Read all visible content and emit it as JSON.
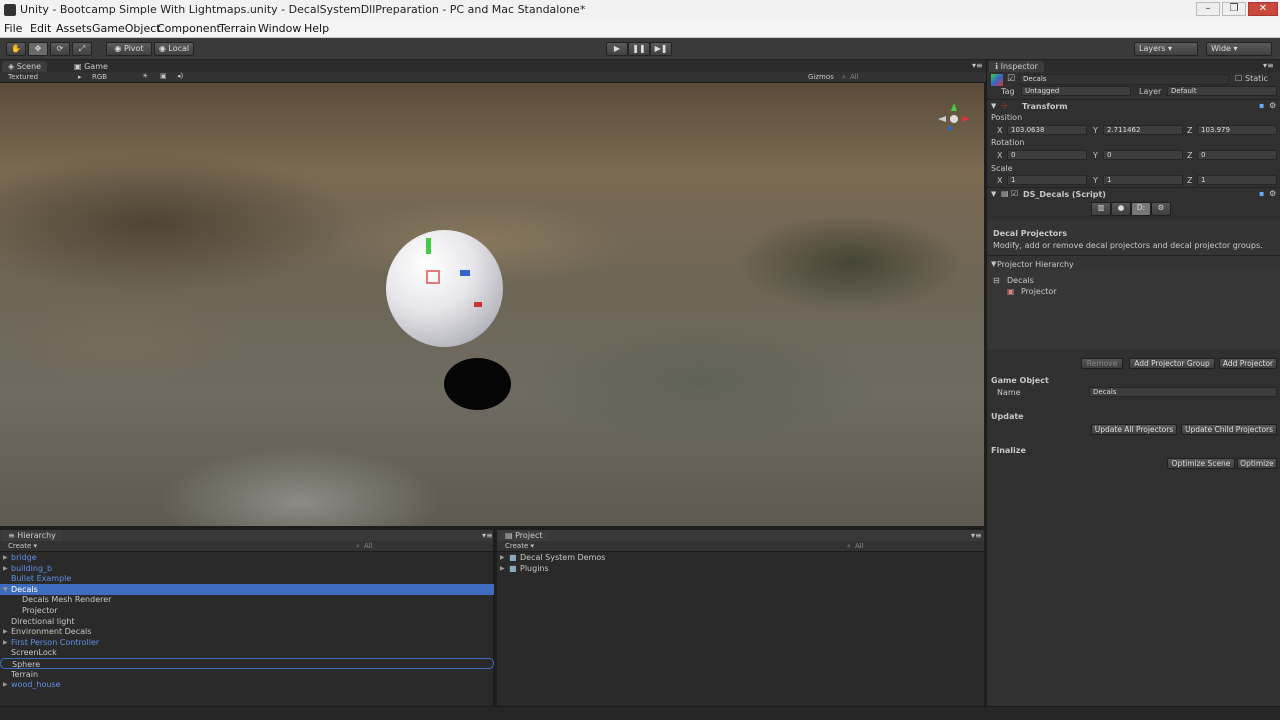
{
  "window": {
    "title": "Unity - Bootcamp Simple With Lightmaps.unity - DecalSystemDllPreparation - PC and Mac Standalone*",
    "minimize": "–",
    "maximize": "❐",
    "close": "✕"
  },
  "menu": [
    "File",
    "Edit",
    "Assets",
    "GameObject",
    "Component",
    "Terrain",
    "Window",
    "Help"
  ],
  "toolbar": {
    "pivot": "Pivot",
    "local": "Local",
    "layers": "Layers",
    "layout": "Wide"
  },
  "scene": {
    "tabs": [
      "Scene",
      "Game"
    ],
    "render_mode": "Textured",
    "color_mode": "RGB",
    "gizmos": "Gizmos",
    "search": "All"
  },
  "inspector": {
    "tab": "Inspector",
    "object_name": "Decals",
    "static_label": "Static",
    "tag_label": "Tag",
    "tag_value": "Untagged",
    "layer_label": "Layer",
    "layer_value": "Default",
    "transform": {
      "title": "Transform",
      "position_label": "Position",
      "position": {
        "x": "103.0638",
        "y": "2.711462",
        "z": "103.979"
      },
      "rotation_label": "Rotation",
      "rotation": {
        "x": "0",
        "y": "0",
        "z": "0"
      },
      "scale_label": "Scale",
      "scale": {
        "x": "1",
        "y": "1",
        "z": "1"
      }
    },
    "script": {
      "title": "DS_Decals (Script)",
      "section_title": "Decal Projectors",
      "description": "Modify, add or remove decal projectors and decal projector groups.",
      "hierarchy_label": "Projector Hierarchy",
      "tree_root": "Decals",
      "tree_child": "Projector",
      "remove_button": "Remove",
      "add_group_button": "Add Projector Group",
      "add_projector_button": "Add Projector",
      "game_object_title": "Game Object",
      "name_label": "Name",
      "name_value": "Decals",
      "update_title": "Update",
      "update_all_button": "Update All Projectors",
      "update_child_button": "Update Child Projectors",
      "finalize_title": "Finalize",
      "optimize_scene_button": "Optimize Scene",
      "optimize_button": "Optimize"
    }
  },
  "hierarchy": {
    "tab": "Hierarchy",
    "create": "Create",
    "search": "All",
    "items": [
      {
        "label": "bridge",
        "link": true,
        "arrow": true,
        "indent": 0
      },
      {
        "label": "building_b",
        "link": true,
        "arrow": true,
        "indent": 0
      },
      {
        "label": "Bullet Example",
        "link": true,
        "arrow": false,
        "indent": 0
      },
      {
        "label": "Decals",
        "link": false,
        "arrow": true,
        "indent": 0,
        "selected": true
      },
      {
        "label": "Decals Mesh Renderer",
        "link": false,
        "arrow": false,
        "indent": 1
      },
      {
        "label": "Projector",
        "link": false,
        "arrow": false,
        "indent": 1
      },
      {
        "label": "Directional light",
        "link": false,
        "arrow": false,
        "indent": 0
      },
      {
        "label": "Environment Decals",
        "link": false,
        "arrow": true,
        "indent": 0
      },
      {
        "label": "First Person Controller",
        "link": true,
        "arrow": true,
        "indent": 0
      },
      {
        "label": "ScreenLock",
        "link": false,
        "arrow": false,
        "indent": 0
      },
      {
        "label": "Sphere",
        "link": false,
        "arrow": false,
        "indent": 0,
        "outlined": true
      },
      {
        "label": "Terrain",
        "link": false,
        "arrow": false,
        "indent": 0
      },
      {
        "label": "wood_house",
        "link": true,
        "arrow": true,
        "indent": 0
      }
    ]
  },
  "project": {
    "tab": "Project",
    "create": "Create",
    "search": "All",
    "items": [
      "Decal System Demos",
      "Plugins"
    ]
  }
}
